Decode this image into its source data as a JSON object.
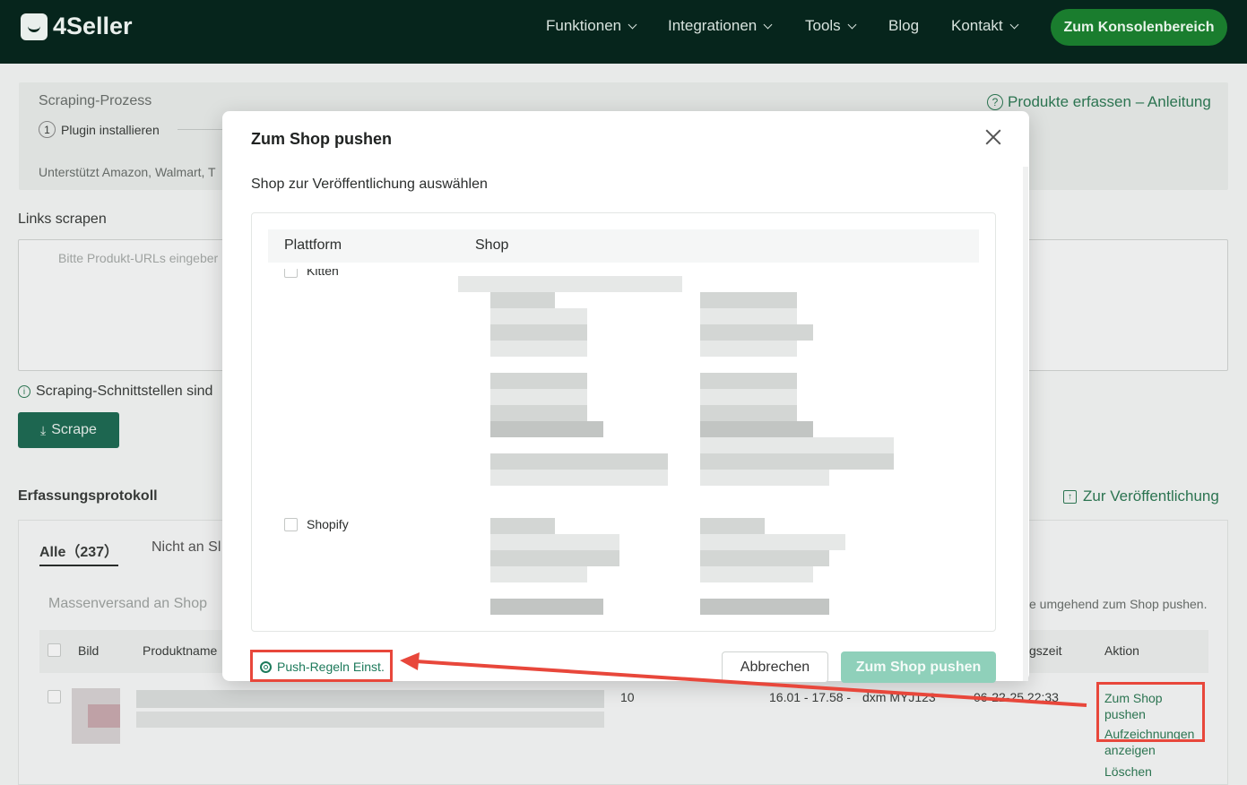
{
  "nav": {
    "brand": "4Seller",
    "items": [
      "Funktionen",
      "Integrationen",
      "Tools",
      "Blog",
      "Kontakt"
    ],
    "console_button": "Zum Konsolenbereich"
  },
  "page": {
    "process_title": "Scraping-Prozess",
    "step1": "1",
    "step1_label": "Plugin installieren",
    "guide_link": "Produkte erfassen – Anleitung",
    "supported": "Unterstützt Amazon, Walmart, T",
    "links_heading": "Links scrapen",
    "url_placeholder": "Bitte Produkt-URLs eingeber",
    "notice": "Scraping-Schnittstellen sind",
    "scrape_button": "Scrape",
    "log_heading": "Erfassungsprotokoll",
    "publish_link": "Zur Veröffentlichung",
    "tab_all": "Alle（237）",
    "tab_other": "Nicht an Sl",
    "bulk": "Massenversand an Shop",
    "bulk_hint": "e umgehend zum Shop pushen.",
    "col_image": "Bild",
    "col_product": "Produktname",
    "col_time": "gszeit",
    "col_action": "Aktion",
    "row_qty": "10",
    "row_price": "16.01 - 17.58 -",
    "row_user": "dxm MYJ123",
    "row_date": "06-22-25 22:33",
    "action_push": "Zum Shop pushen",
    "action_records": "Aufzeichnungen anzeigen",
    "action_delete": "Löschen"
  },
  "modal": {
    "title": "Zum Shop pushen",
    "subtitle": "Shop zur Veröffentlichung auswählen",
    "col_platform": "Plattform",
    "col_shop": "Shop",
    "platform_partial": "Kitten",
    "platform_shopify": "Shopify",
    "push_rules": "Push-Regeln Einst.",
    "cancel": "Abbrechen",
    "submit": "Zum Shop pushen"
  },
  "colors": {
    "nav_bg": "#06251c",
    "brand_green": "#1a7d2e",
    "accent": "#1d7a5b",
    "submit_disabled": "#8fd0ba",
    "annotation": "#e8473b"
  }
}
